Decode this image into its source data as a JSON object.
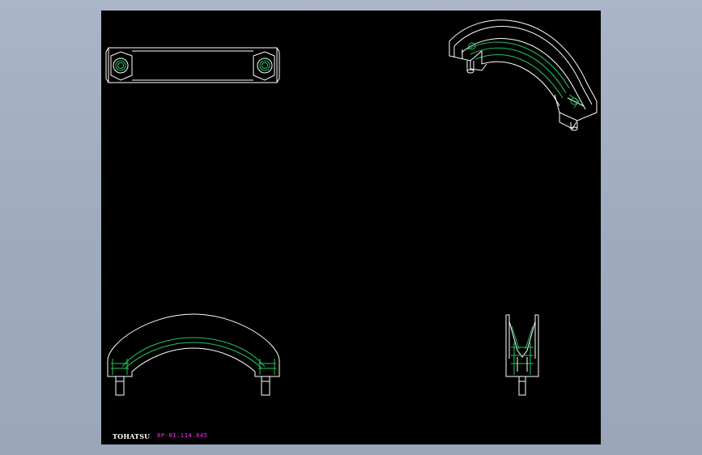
{
  "drawing": {
    "brand_text": "TOHATSU",
    "part_number": "8P-01.114.845",
    "colors": {
      "viewport_background": "#aab5c7",
      "sheet_background": "#000000",
      "outline": "#ffffff",
      "detail_lines": "#22c55e",
      "part_number_text": "#ff2cff"
    },
    "views": [
      "top-view",
      "isometric-view",
      "front-view",
      "side-view"
    ]
  }
}
